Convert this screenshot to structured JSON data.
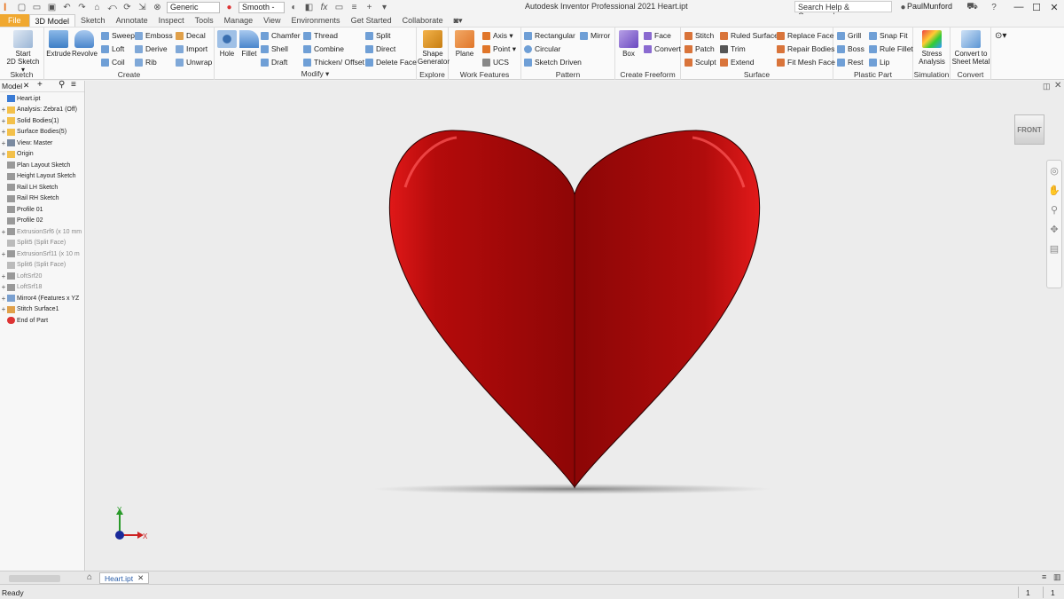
{
  "titlebar": {
    "appearance_value": "Generic",
    "visual_style_value": "Smooth -",
    "app_title": "Autodesk Inventor Professional 2021  Heart.ipt",
    "search_placeholder": "Search Help & Commands...",
    "user": "PaulMunford",
    "help": "?",
    "minimize": "—",
    "maximize": "☐",
    "close": "✕"
  },
  "tabs": [
    "File",
    "3D Model",
    "Sketch",
    "Annotate",
    "Inspect",
    "Tools",
    "Manage",
    "View",
    "Environments",
    "Get Started",
    "Collaborate"
  ],
  "ribbon": {
    "panels": {
      "sketch": "Sketch",
      "create": "Create",
      "modify": "Modify ▾",
      "explore": "Explore",
      "work_features": "Work Features",
      "pattern": "Pattern",
      "create_freeform": "Create Freeform",
      "surface": "Surface",
      "plastic_part": "Plastic Part",
      "simulation": "Simulation",
      "convert": "Convert"
    },
    "buttons": {
      "start_sketch_1": "Start",
      "start_sketch_2": "2D Sketch ▾",
      "extrude": "Extrude",
      "revolve": "Revolve",
      "sweep": "Sweep",
      "loft": "Loft",
      "coil": "Coil",
      "emboss": "Emboss",
      "derive": "Derive",
      "rib": "Rib",
      "decal": "Decal",
      "import": "Import",
      "unwrap": "Unwrap",
      "hole": "Hole",
      "fillet": "Fillet",
      "chamfer": "Chamfer",
      "shell": "Shell",
      "draft": "Draft",
      "thread": "Thread",
      "combine": "Combine",
      "thicken": "Thicken/ Offset",
      "split": "Split",
      "direct": "Direct",
      "delete_face": "Delete Face",
      "shape_gen_1": "Shape",
      "shape_gen_2": "Generator",
      "plane": "Plane",
      "axis": "Axis ▾",
      "point": "Point ▾",
      "ucs": "UCS",
      "rectangular": "Rectangular",
      "circular": "Circular",
      "sketch_driven": "Sketch Driven",
      "mirror": "Mirror",
      "box": "Box",
      "face": "Face",
      "convert_ff": "Convert",
      "stitch": "Stitch",
      "patch": "Patch",
      "sculpt": "Sculpt",
      "ruled_surface": "Ruled Surface",
      "trim": "Trim",
      "extend": "Extend",
      "replace_face": "Replace Face",
      "repair_bodies": "Repair Bodies",
      "fit_mesh_face": "Fit Mesh Face",
      "grill": "Grill",
      "boss": "Boss",
      "rest": "Rest",
      "snap_fit": "Snap Fit",
      "rule_fillet": "Rule Fillet",
      "lip": "Lip",
      "stress_1": "Stress",
      "stress_2": "Analysis",
      "convert_sm_1": "Convert to",
      "convert_sm_2": "Sheet Metal"
    }
  },
  "browser": {
    "title": "Model",
    "items": [
      {
        "label": "Heart.ipt",
        "dim": false
      },
      {
        "label": "Analysis: Zebra1 (Off)",
        "dim": false
      },
      {
        "label": "Solid Bodies(1)",
        "dim": false
      },
      {
        "label": "Surface Bodies(5)",
        "dim": false
      },
      {
        "label": "View: Master",
        "dim": false
      },
      {
        "label": "Origin",
        "dim": false
      },
      {
        "label": "Plan Layout Sketch",
        "dim": false
      },
      {
        "label": "Height Layout Sketch",
        "dim": false
      },
      {
        "label": "Rail LH Sketch",
        "dim": false
      },
      {
        "label": "Rail RH Sketch",
        "dim": false
      },
      {
        "label": "Profile 01",
        "dim": false
      },
      {
        "label": "Profile 02",
        "dim": false
      },
      {
        "label": "ExtrusionSrf6 (x 10 mm",
        "dim": true
      },
      {
        "label": "Split5 (Split Face)",
        "dim": true
      },
      {
        "label": "ExtrusionSrf11 (x 10 m",
        "dim": true
      },
      {
        "label": "Split6 (Split Face)",
        "dim": true
      },
      {
        "label": "LoftSrf20",
        "dim": true
      },
      {
        "label": "LoftSrf18",
        "dim": true
      },
      {
        "label": "Mirror4 (Features x YZ",
        "dim": false
      },
      {
        "label": "Stitch Surface1",
        "dim": false
      },
      {
        "label": "End of Part",
        "dim": false
      }
    ]
  },
  "viewport": {
    "viewcube_label": "FRONT",
    "axis_y": "Y",
    "axis_x": "X",
    "model_color": "#b00d0d"
  },
  "doc_tab": "Heart.ipt",
  "status": {
    "text": "Ready",
    "count_1": "1",
    "count_2": "1"
  }
}
